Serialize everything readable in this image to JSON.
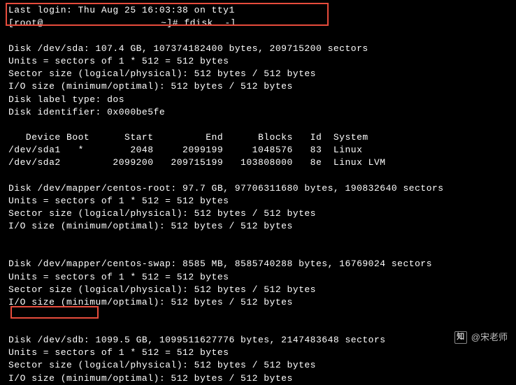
{
  "login": {
    "last_login": "Last login: Thu Aug 25 16:03:38 on tty1",
    "prompt_prefix": "[root@",
    "prompt_suffix": " ~]# fdisk  -l"
  },
  "disk_sda": {
    "header": "Disk /dev/sda: 107.4 GB, 107374182400 bytes, 209715200 sectors",
    "units": "Units = sectors of 1 * 512 = 512 bytes",
    "sector": "Sector size (logical/physical): 512 bytes / 512 bytes",
    "io": "I/O size (minimum/optimal): 512 bytes / 512 bytes",
    "label": "Disk label type: dos",
    "identifier": "Disk identifier: 0x000be5fe"
  },
  "partition_table": {
    "header": "   Device Boot      Start         End      Blocks   Id  System",
    "row1": "/dev/sda1   *        2048     2099199     1048576   83  Linux",
    "row2": "/dev/sda2         2099200   209715199   103808000   8e  Linux LVM"
  },
  "disk_root": {
    "header": "Disk /dev/mapper/centos-root: 97.7 GB, 97706311680 bytes, 190832640 sectors",
    "units": "Units = sectors of 1 * 512 = 512 bytes",
    "sector": "Sector size (logical/physical): 512 bytes / 512 bytes",
    "io": "I/O size (minimum/optimal): 512 bytes / 512 bytes"
  },
  "disk_swap": {
    "header": "Disk /dev/mapper/centos-swap: 8585 MB, 8585740288 bytes, 16769024 sectors",
    "units": "Units = sectors of 1 * 512 = 512 bytes",
    "sector": "Sector size (logical/physical): 512 bytes / 512 bytes",
    "io": "I/O size (minimum/optimal): 512 bytes / 512 bytes"
  },
  "disk_sdb": {
    "header_prefix": "Disk /dev/sdb:",
    "header_suffix": " 1099.5 GB, 1099511627776 bytes, 2147483648 sectors",
    "units": "Units = sectors of 1 * 512 = 512 bytes",
    "sector": "Sector size (logical/physical): 512 bytes / 512 bytes",
    "io": "I/O size (minimum/optimal): 512 bytes / 512 bytes"
  },
  "watermark": {
    "icon_text": "知",
    "author": "@宋老师"
  }
}
